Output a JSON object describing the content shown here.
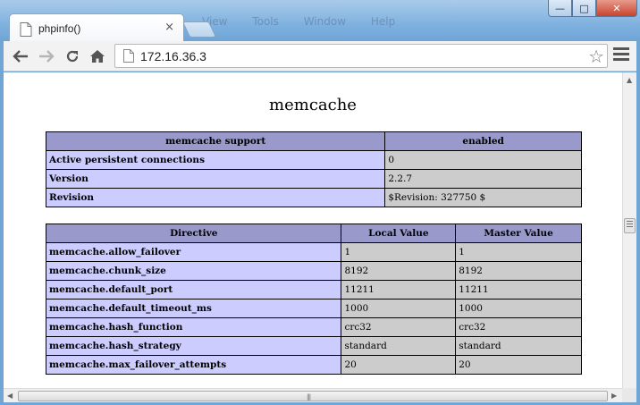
{
  "browser": {
    "tab_title": "phpinfo()",
    "tab_close": "×",
    "url": "172.16.36.3",
    "window_controls": {
      "minimize": "—",
      "maximize": "□",
      "close": "✕"
    },
    "background_menu": [
      "View",
      "Tools",
      "Window",
      "Help"
    ]
  },
  "page": {
    "heading": "memcache",
    "support_table": {
      "headers": [
        "memcache support",
        "enabled"
      ],
      "rows": [
        [
          "Active persistent connections",
          "0"
        ],
        [
          "Version",
          "2.2.7"
        ],
        [
          "Revision",
          "$Revision: 327750 $"
        ]
      ]
    },
    "directive_table": {
      "headers": [
        "Directive",
        "Local Value",
        "Master Value"
      ],
      "rows": [
        [
          "memcache.allow_failover",
          "1",
          "1"
        ],
        [
          "memcache.chunk_size",
          "8192",
          "8192"
        ],
        [
          "memcache.default_port",
          "11211",
          "11211"
        ],
        [
          "memcache.default_timeout_ms",
          "1000",
          "1000"
        ],
        [
          "memcache.hash_function",
          "crc32",
          "crc32"
        ],
        [
          "memcache.hash_strategy",
          "standard",
          "standard"
        ],
        [
          "memcache.max_failover_attempts",
          "20",
          "20"
        ]
      ]
    }
  },
  "colors": {
    "header_bg": "#9999cc",
    "label_bg": "#ccccff",
    "value_bg": "#cccccc"
  },
  "icons": [
    "page-icon",
    "back-arrow-icon",
    "forward-arrow-icon",
    "reload-icon",
    "home-icon",
    "star-icon",
    "menu-icon"
  ]
}
